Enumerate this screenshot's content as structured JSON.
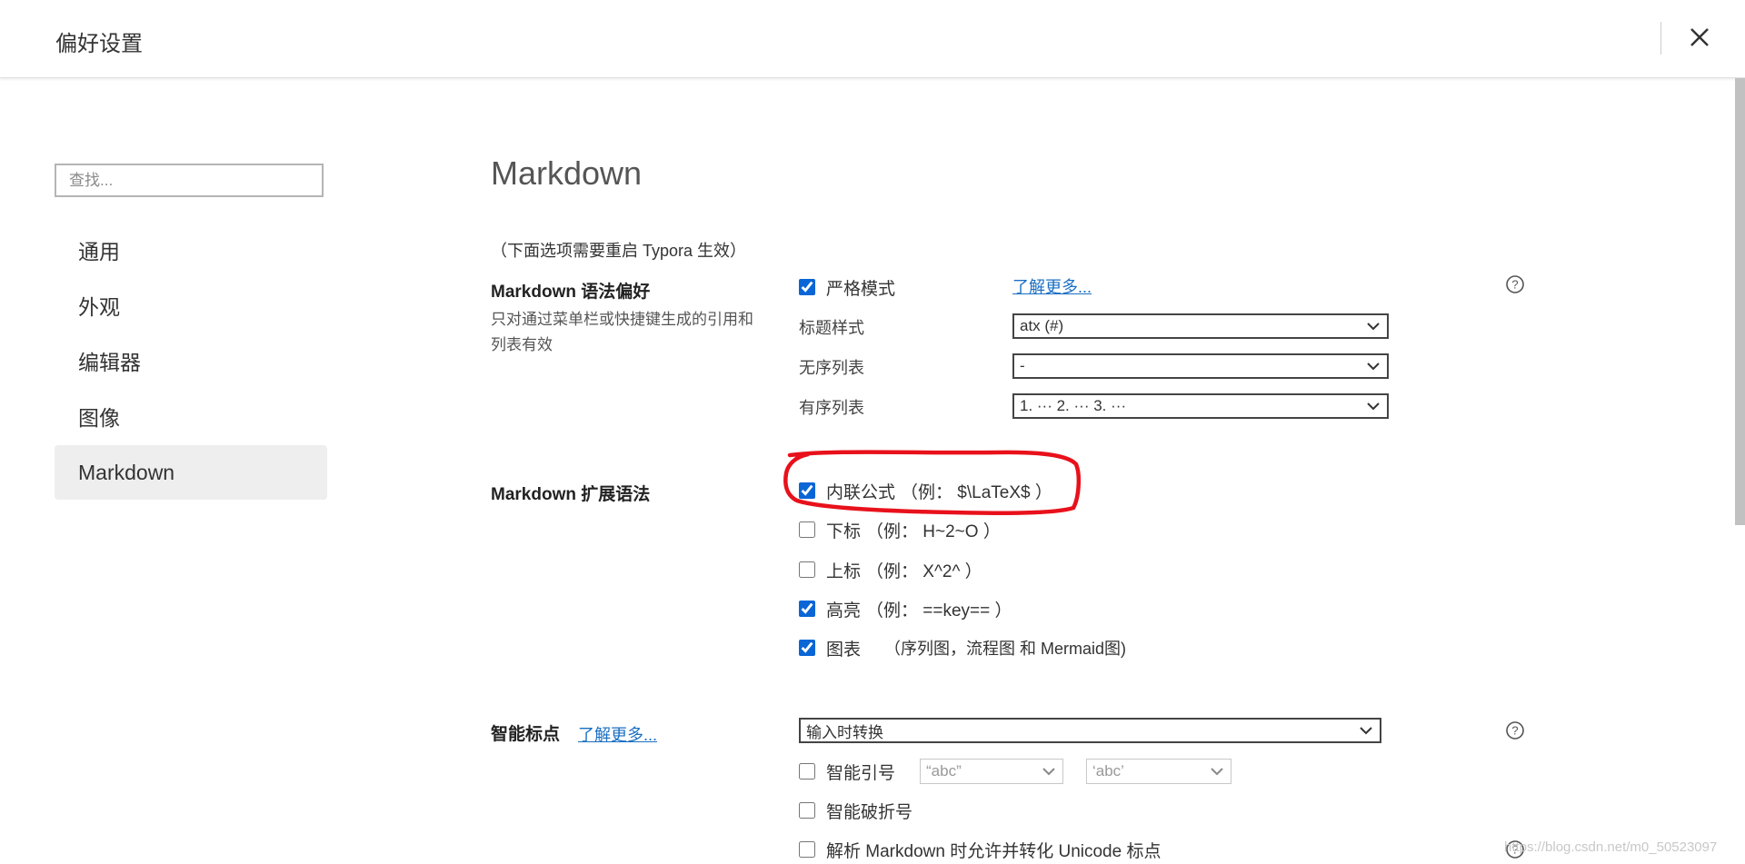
{
  "header": {
    "title": "偏好设置"
  },
  "sidebar": {
    "search_placeholder": "查找...",
    "items": [
      {
        "label": "通用"
      },
      {
        "label": "外观"
      },
      {
        "label": "编辑器"
      },
      {
        "label": "图像"
      },
      {
        "label": "Markdown",
        "active": true
      }
    ]
  },
  "main": {
    "title": "Markdown",
    "restart_note": "（下面选项需要重启 Typora 生效）",
    "syntax_pref": {
      "label": "Markdown 语法偏好",
      "description": "只对通过菜单栏或快捷键生成的引用和列表有效",
      "strict_mode": {
        "label": "严格模式",
        "checked": true
      },
      "learn_more": "了解更多...",
      "heading_style": {
        "label": "标题样式",
        "value": "atx (#)"
      },
      "unordered_list": {
        "label": "无序列表",
        "value": "-"
      },
      "ordered_list": {
        "label": "有序列表",
        "value": "1. ··· 2. ··· 3. ···"
      }
    },
    "extended_syntax": {
      "label": "Markdown 扩展语法",
      "options": [
        {
          "label": "内联公式",
          "note": "（例： $\\LaTeX$ ）",
          "checked": true
        },
        {
          "label": "下标",
          "note": "（例： H~2~O ）",
          "checked": false
        },
        {
          "label": "上标",
          "note": "（例： X^2^ ）",
          "checked": false
        },
        {
          "label": "高亮",
          "note": "（例： ==key== ）",
          "checked": true
        },
        {
          "label": "图表",
          "note": "（序列图，流程图 和 Mermaid图)",
          "checked": true
        }
      ]
    },
    "smart_punct": {
      "label": "智能标点",
      "learn_more": "了解更多...",
      "mode": "输入时转换",
      "smart_quotes": {
        "label": "智能引号",
        "checked": false,
        "double": "“abc”",
        "single": "‘abc’"
      },
      "smart_dash": {
        "label": "智能破折号",
        "checked": false
      },
      "unicode": {
        "label": "解析 Markdown 时允许并转化 Unicode 标点",
        "checked": false
      }
    }
  },
  "watermark": "https://blog.csdn.net/m0_50523097",
  "colors": {
    "accent": "#0a66d6",
    "link": "#1a6fc4",
    "annotation": "#e8111b",
    "active_nav": "#eeeeee"
  }
}
